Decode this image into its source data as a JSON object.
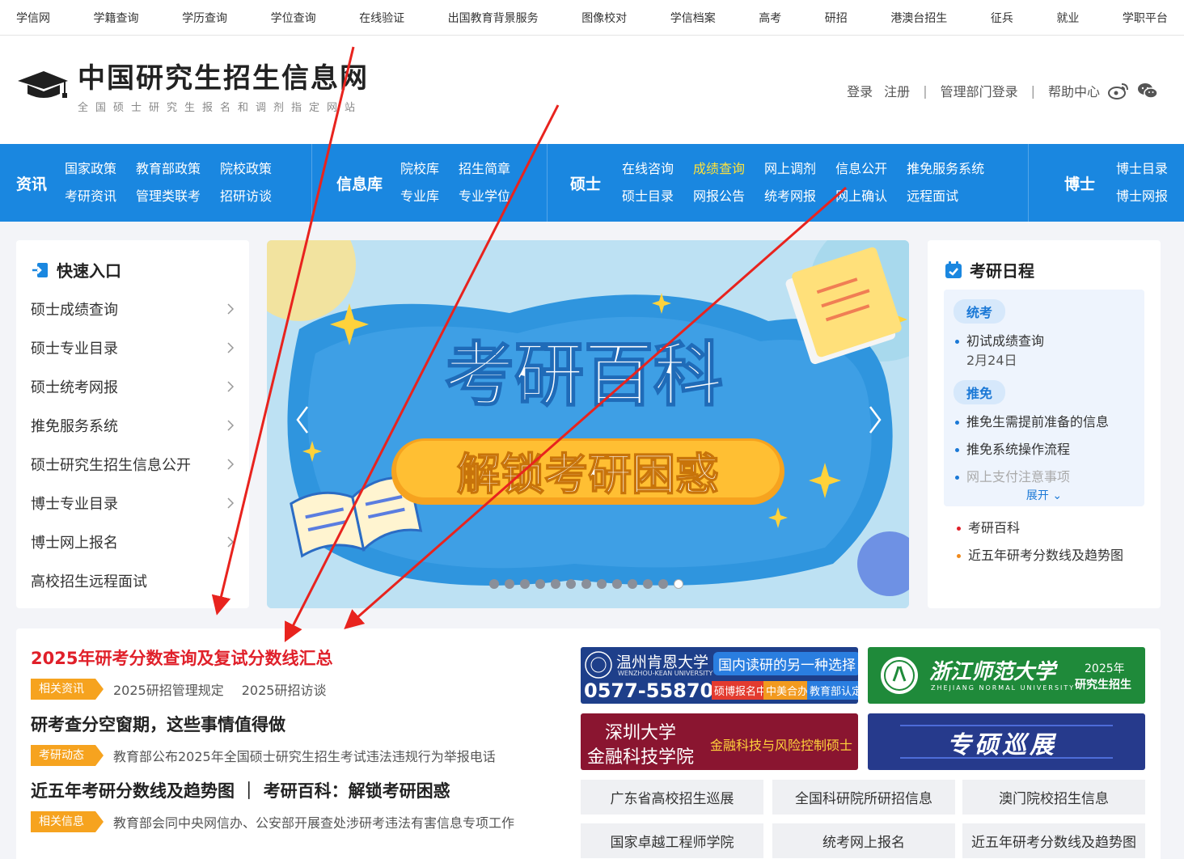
{
  "topbar": [
    "学信网",
    "学籍查询",
    "学历查询",
    "学位查询",
    "在线验证",
    "出国教育背景服务",
    "图像校对",
    "学信档案",
    "高考",
    "研招",
    "港澳台招生",
    "征兵",
    "就业",
    "学职平台"
  ],
  "header": {
    "title": "中国研究生招生信息网",
    "subtitle": "全国硕士研究生报名和调剂指定网站",
    "login": "登录",
    "register": "注册",
    "admin_login": "管理部门登录",
    "help": "帮助中心"
  },
  "nav": {
    "info": {
      "label": "资讯",
      "links": [
        "国家政策",
        "考研资讯",
        "教育部政策",
        "管理类联考",
        "院校政策",
        "招研访谈"
      ]
    },
    "db": {
      "label": "信息库",
      "links": [
        "院校库",
        "专业库",
        "招生简章",
        "专业学位"
      ]
    },
    "master": {
      "label": "硕士",
      "links": [
        "在线咨询",
        "硕士目录",
        "成绩查询",
        "网报公告",
        "网上调剂",
        "统考网报",
        "信息公开",
        "网上确认",
        "推免服务系统",
        "远程面试"
      ]
    },
    "doctor": {
      "label": "博士",
      "links": [
        "博士目录",
        "博士网报"
      ]
    }
  },
  "quick": {
    "title": "快速入口",
    "items": [
      "硕士成绩查询",
      "硕士专业目录",
      "硕士统考网报",
      "推免服务系统",
      "硕士研究生招生信息公开",
      "博士专业目录",
      "博士网上报名",
      "高校招生远程面试"
    ]
  },
  "banner": {
    "headline": "考研百科",
    "button": "解锁考研困惑",
    "slides": 13,
    "active_slide": 13
  },
  "schedule": {
    "title": "考研日程",
    "groups": [
      {
        "tag": "统考",
        "items": [
          {
            "text": "初试成绩查询",
            "date": "2月24日"
          }
        ]
      },
      {
        "tag": "推免",
        "items": [
          {
            "text": "推免生需提前准备的信息"
          },
          {
            "text": "推免系统操作流程"
          },
          {
            "text": "网上支付注意事项"
          }
        ]
      }
    ],
    "expand": "展开",
    "links": [
      {
        "text": "考研百科",
        "color": "#e0202a"
      },
      {
        "text": "近五年研考分数线及趋势图",
        "color": "#f08a1c"
      }
    ]
  },
  "news": [
    {
      "title": "2025年研考分数查询及复试分数线汇总",
      "red": true,
      "tag": "相关资讯",
      "subs": [
        "2025研招管理规定",
        "2025研招访谈"
      ]
    },
    {
      "title": "研考查分空窗期，这些事情值得做",
      "red": false,
      "tag": "考研动态",
      "subs": [
        "教育部公布2025年全国硕士研究生招生考试违法违规行为举报电话"
      ]
    },
    {
      "title": "近五年考研分数线及趋势图 ｜ 考研百科：解锁考研困惑",
      "red": false,
      "tag": "相关信息",
      "subs": [
        "教育部会同中央网信办、公安部开展查处涉研考违法有害信息专项工作"
      ]
    }
  ],
  "ads": {
    "wku": {
      "name": "温州肯恩大学",
      "en": "WENZHOU-KEAN UNIVERSITY",
      "slogan": "国内读研的另一种选择",
      "phone": "0577-55870888",
      "tags": [
        "硕博报名中",
        "中美合办",
        "教育部认定"
      ]
    },
    "zjnu": {
      "name": "浙江师范大学",
      "en": "ZHEJIANG NORMAL UNIVERSITY",
      "year": "2025年",
      "text": "研究生招生"
    },
    "szu": {
      "line1": "深圳大学",
      "line2": "金融科技学院",
      "program": "金融科技与风险控制硕士"
    },
    "tour": {
      "text": "专硕巡展"
    }
  },
  "quick_links": [
    "广东省高校招生巡展",
    "全国科研院所研招信息",
    "澳门院校招生信息",
    "国家卓越工程师学院",
    "统考网上报名",
    "近五年研考分数线及趋势图"
  ]
}
